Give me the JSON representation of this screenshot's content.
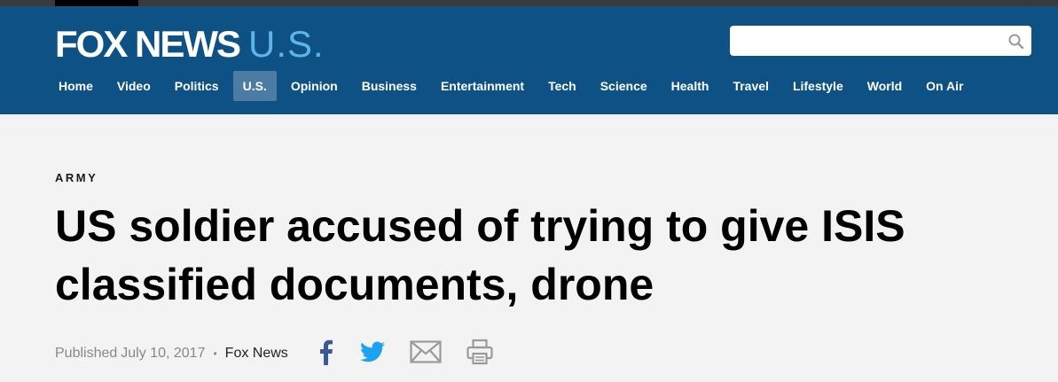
{
  "header": {
    "brand": "FOX NEWS",
    "section": "U.S.",
    "search": {
      "value": "",
      "placeholder": ""
    }
  },
  "nav": {
    "items": [
      {
        "label": "Home",
        "active": false
      },
      {
        "label": "Video",
        "active": false
      },
      {
        "label": "Politics",
        "active": false
      },
      {
        "label": "U.S.",
        "active": true
      },
      {
        "label": "Opinion",
        "active": false
      },
      {
        "label": "Business",
        "active": false
      },
      {
        "label": "Entertainment",
        "active": false
      },
      {
        "label": "Tech",
        "active": false
      },
      {
        "label": "Science",
        "active": false
      },
      {
        "label": "Health",
        "active": false
      },
      {
        "label": "Travel",
        "active": false
      },
      {
        "label": "Lifestyle",
        "active": false
      },
      {
        "label": "World",
        "active": false
      },
      {
        "label": "On Air",
        "active": false
      }
    ]
  },
  "article": {
    "eyebrow": "ARMY",
    "headline": "US soldier accused of trying to give ISIS classified documents, drone",
    "published_label": "Published",
    "published_date": "July 10, 2017",
    "separator": "•",
    "source": "Fox News"
  },
  "share": {
    "icons": [
      "facebook-icon",
      "twitter-icon",
      "email-icon",
      "print-icon"
    ]
  },
  "colors": {
    "header_bg": "#0e5185",
    "active_nav": "#4c7ca3",
    "section_accent": "#5cb4e8",
    "facebook": "#3b5998",
    "twitter": "#1da1f2",
    "icon_gray": "#9a9a9a",
    "page_bg": "#f3f3f3"
  }
}
